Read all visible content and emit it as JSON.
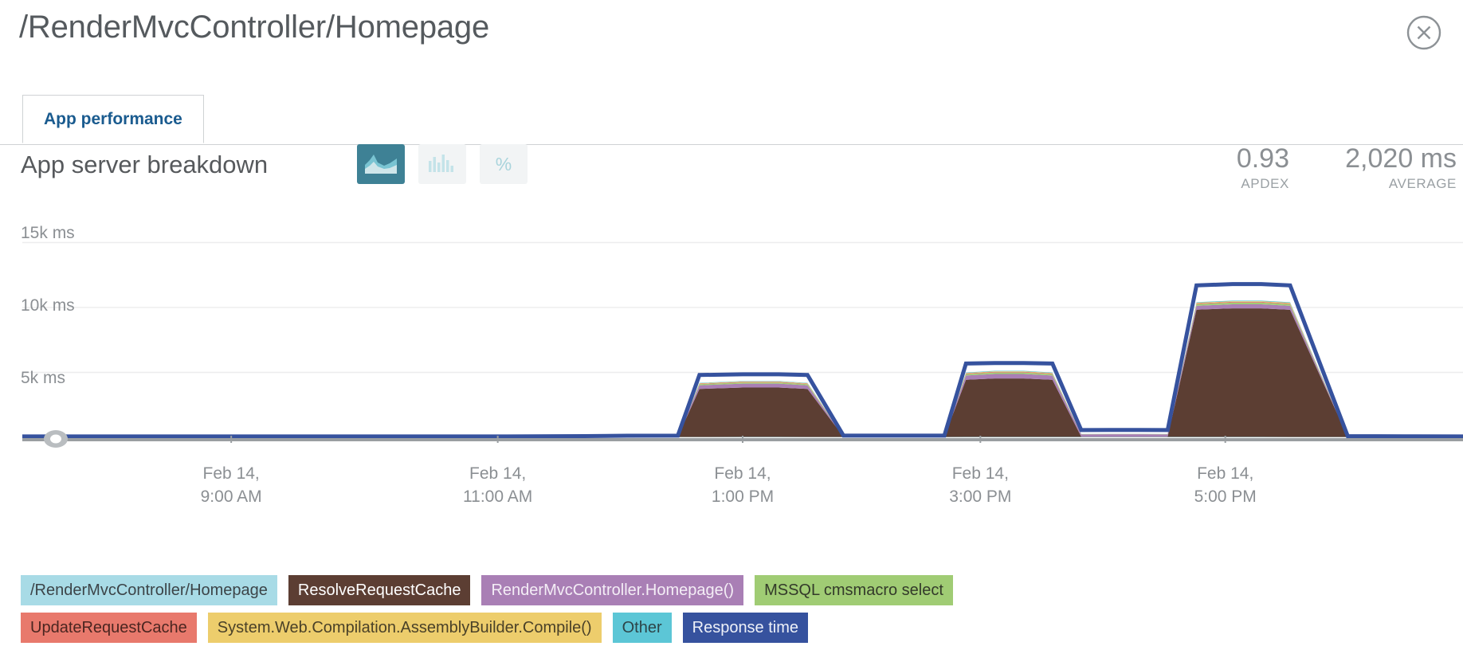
{
  "header": {
    "title": "/RenderMvcController/Homepage",
    "close_icon": "close-circle-icon"
  },
  "tabs": [
    {
      "label": "App performance",
      "active": true
    }
  ],
  "chart_header": {
    "title": "App server breakdown",
    "view_buttons": [
      {
        "name": "area-chart-view",
        "icon": "area-chart-icon",
        "label": "",
        "active": true
      },
      {
        "name": "bar-chart-view",
        "icon": "bar-chart-icon",
        "label": "",
        "active": false
      },
      {
        "name": "percent-view",
        "icon": "percent-icon",
        "label": "%",
        "active": false
      }
    ],
    "metrics": [
      {
        "value": "0.93",
        "label": "APDEX"
      },
      {
        "value": "2,020 ms",
        "label": "AVERAGE"
      }
    ]
  },
  "chart_data": {
    "type": "area",
    "title": "App server breakdown",
    "xlabel": "",
    "ylabel": "ms",
    "ylim": [
      0,
      16500
    ],
    "yticks": [
      5000,
      10000,
      15000
    ],
    "ytick_labels": [
      "5k ms",
      "10k ms",
      "15k ms"
    ],
    "grid": true,
    "legend_position": "bottom",
    "xtick_labels": [
      "Feb 14,\n9:00 AM",
      "Feb 14,\n11:00 AM",
      "Feb 14,\n1:00 PM",
      "Feb 14,\n3:00 PM",
      "Feb 14,\n5:00 PM"
    ],
    "xticks": [
      {
        "line1": "Feb 14,",
        "line2": "9:00 AM",
        "pos": 0.145
      },
      {
        "line1": "Feb 14,",
        "line2": "11:00 AM",
        "pos": 0.33
      },
      {
        "line1": "Feb 14,",
        "line2": "1:00 PM",
        "pos": 0.5
      },
      {
        "line1": "Feb 14,",
        "line2": "3:00 PM",
        "pos": 0.665
      },
      {
        "line1": "Feb 14,",
        "line2": "5:00 PM",
        "pos": 0.835
      }
    ],
    "x": [
      0,
      0.04,
      0.08,
      0.145,
      0.21,
      0.275,
      0.33,
      0.39,
      0.42,
      0.455,
      0.47,
      0.5,
      0.525,
      0.545,
      0.57,
      0.605,
      0.64,
      0.655,
      0.675,
      0.695,
      0.715,
      0.735,
      0.755,
      0.775,
      0.795,
      0.815,
      0.84,
      0.86,
      0.88,
      0.92,
      0.96,
      1.0
    ],
    "series": [
      {
        "name": "/RenderMvcController/Homepage",
        "color": "#a8dbe6",
        "values": [
          20,
          20,
          20,
          20,
          20,
          20,
          20,
          20,
          25,
          25,
          25,
          30,
          30,
          25,
          25,
          25,
          25,
          30,
          30,
          30,
          30,
          30,
          30,
          30,
          30,
          30,
          30,
          30,
          25,
          20,
          20,
          20
        ]
      },
      {
        "name": "ResolveRequestCache",
        "color": "#5c3e33",
        "values": [
          10,
          10,
          10,
          10,
          10,
          10,
          10,
          10,
          20,
          20,
          3700,
          3800,
          3800,
          3700,
          20,
          20,
          20,
          4400,
          4500,
          4500,
          4400,
          20,
          20,
          20,
          20,
          9800,
          9900,
          9900,
          9800,
          10,
          10,
          10
        ]
      },
      {
        "name": "RenderMvcController.Homepage()",
        "color": "#a97fb5",
        "values": [
          15,
          15,
          15,
          15,
          15,
          15,
          15,
          20,
          25,
          25,
          280,
          300,
          300,
          280,
          25,
          25,
          25,
          330,
          350,
          350,
          330,
          180,
          190,
          190,
          180,
          300,
          310,
          310,
          300,
          20,
          15,
          15
        ]
      },
      {
        "name": "MSSQL cmsmacro select",
        "color": "#a0cc74",
        "values": [
          8,
          8,
          8,
          8,
          8,
          8,
          8,
          8,
          10,
          10,
          90,
          95,
          95,
          90,
          10,
          10,
          10,
          110,
          115,
          115,
          110,
          12,
          12,
          12,
          12,
          130,
          135,
          135,
          130,
          10,
          8,
          8
        ]
      },
      {
        "name": "UpdateRequestCache",
        "color": "#e8796c",
        "values": [
          5,
          5,
          5,
          5,
          5,
          5,
          5,
          5,
          6,
          6,
          40,
          42,
          42,
          40,
          6,
          6,
          6,
          50,
          52,
          52,
          50,
          6,
          6,
          6,
          6,
          60,
          62,
          62,
          60,
          5,
          5,
          5
        ]
      },
      {
        "name": "System.Web.Compilation.AssemblyBuilder.Compile()",
        "color": "#edcd6c",
        "values": [
          4,
          4,
          4,
          4,
          4,
          4,
          4,
          4,
          5,
          5,
          30,
          32,
          32,
          30,
          5,
          5,
          5,
          36,
          38,
          38,
          36,
          5,
          5,
          5,
          5,
          44,
          46,
          46,
          44,
          4,
          4,
          4
        ]
      },
      {
        "name": "Other",
        "color": "#5cc6d6",
        "values": [
          6,
          6,
          6,
          6,
          6,
          6,
          6,
          6,
          8,
          8,
          30,
          32,
          32,
          30,
          8,
          8,
          8,
          36,
          38,
          38,
          36,
          8,
          8,
          8,
          8,
          44,
          46,
          46,
          44,
          6,
          6,
          6
        ]
      }
    ],
    "overlay_line": {
      "name": "Response time",
      "color": "#36529e",
      "values": [
        70,
        70,
        70,
        70,
        70,
        70,
        70,
        90,
        120,
        130,
        4800,
        4850,
        4850,
        4800,
        130,
        130,
        130,
        5680,
        5720,
        5720,
        5680,
        560,
        570,
        570,
        560,
        11700,
        11800,
        11800,
        11700,
        90,
        75,
        70
      ]
    }
  },
  "legend": {
    "rows": [
      [
        {
          "label": "/RenderMvcController/Homepage",
          "bg": "#a8dbe6",
          "fg": "#3c4448"
        },
        {
          "label": "ResolveRequestCache",
          "bg": "#5c3e33",
          "fg": "#ffffff"
        },
        {
          "label": "RenderMvcController.Homepage()",
          "bg": "#a97fb5",
          "fg": "#f4eef6"
        },
        {
          "label": "MSSQL cmsmacro select",
          "bg": "#a0cc74",
          "fg": "#333a2a"
        }
      ],
      [
        {
          "label": "UpdateRequestCache",
          "bg": "#e8796c",
          "fg": "#4a2520"
        },
        {
          "label": "System.Web.Compilation.AssemblyBuilder.Compile()",
          "bg": "#edcd6c",
          "fg": "#4a4128"
        },
        {
          "label": "Other",
          "bg": "#5cc6d6",
          "fg": "#2d4448"
        },
        {
          "label": "Response time",
          "bg": "#36529e",
          "fg": "#eef1f8"
        }
      ]
    ]
  }
}
